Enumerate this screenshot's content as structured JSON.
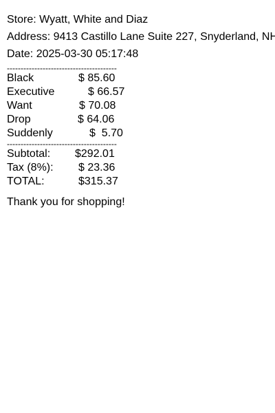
{
  "header": {
    "store": "Store: Wyatt, White and Diaz",
    "address": "Address: 9413 Castillo Lane Suite 227, Snyderland, NH",
    "date": "Date: 2025-03-30 05:17:48"
  },
  "divider": "----------------------------------------",
  "items": [
    {
      "name": "Black",
      "price": "$ 85.60"
    },
    {
      "name": "Executive",
      "price": "$ 66.57"
    },
    {
      "name": "Want",
      "price": "$ 70.08"
    },
    {
      "name": "Drop",
      "price": "$ 64.06"
    },
    {
      "name": "Suddenly",
      "price": "$  5.70"
    }
  ],
  "totals": {
    "subtotal_label": "Subtotal:",
    "subtotal_value": "$292.01",
    "tax_label": "Tax (8%):",
    "tax_value": "$ 23.36",
    "total_label": "TOTAL:",
    "total_value": "$315.37"
  },
  "footer": {
    "thanks": "Thank you for shopping!"
  }
}
